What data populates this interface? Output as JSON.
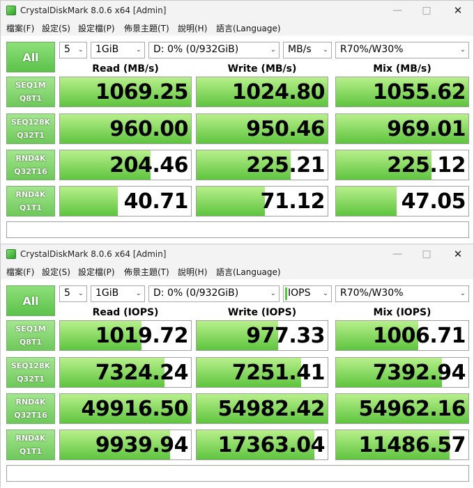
{
  "windows": [
    {
      "title": "CrystalDiskMark 8.0.6 x64 [Admin]",
      "menu": [
        "檔案(F)",
        "設定(S)",
        "設定檔(P)",
        "佈景主題(T)",
        "說明(H)",
        "語言(Language)"
      ],
      "all_label": "All",
      "count": "5",
      "size": "1GiB",
      "drive": "D: 0% (0/932GiB)",
      "unit": "MB/s",
      "mix": "R70%/W30%",
      "headers": [
        "Read (MB/s)",
        "Write (MB/s)",
        "Mix (MB/s)"
      ],
      "rows": [
        {
          "line1": "SEQ1M",
          "line2": "Q8T1",
          "values": [
            "1069.25",
            "1024.80",
            "1055.62"
          ],
          "fill": [
            1.0,
            1.0,
            1.0
          ]
        },
        {
          "line1": "SEQ128K",
          "line2": "Q32T1",
          "values": [
            "960.00",
            "950.46",
            "969.01"
          ],
          "fill": [
            1.0,
            1.0,
            1.0
          ]
        },
        {
          "line1": "RND4K",
          "line2": "Q32T16",
          "values": [
            "204.46",
            "225.21",
            "225.12"
          ],
          "fill": [
            0.69,
            0.72,
            0.72
          ]
        },
        {
          "line1": "RND4K",
          "line2": "Q1T1",
          "values": [
            "40.71",
            "71.12",
            "47.05"
          ],
          "fill": [
            0.44,
            0.52,
            0.46
          ]
        }
      ],
      "status": ""
    },
    {
      "title": "CrystalDiskMark 8.0.6 x64 [Admin]",
      "menu": [
        "檔案(F)",
        "設定(S)",
        "設定檔(P)",
        "佈景主題(T)",
        "說明(H)",
        "語言(Language)"
      ],
      "all_label": "All",
      "count": "5",
      "size": "1GiB",
      "drive": "D: 0% (0/932GiB)",
      "unit": "IOPS",
      "mix": "R70%/W30%",
      "headers": [
        "Read (IOPS)",
        "Write (IOPS)",
        "Mix (IOPS)"
      ],
      "rows": [
        {
          "line1": "SEQ1M",
          "line2": "Q8T1",
          "values": [
            "1019.72",
            "977.33",
            "1006.71"
          ],
          "fill": [
            0.62,
            0.62,
            0.62
          ]
        },
        {
          "line1": "SEQ128K",
          "line2": "Q32T1",
          "values": [
            "7324.24",
            "7251.41",
            "7392.94"
          ],
          "fill": [
            0.8,
            0.8,
            0.8
          ]
        },
        {
          "line1": "RND4K",
          "line2": "Q32T16",
          "values": [
            "49916.50",
            "54982.42",
            "54962.16"
          ],
          "fill": [
            1.0,
            1.0,
            1.0
          ]
        },
        {
          "line1": "RND4K",
          "line2": "Q1T1",
          "values": [
            "9939.94",
            "17363.04",
            "11486.57"
          ],
          "fill": [
            0.84,
            0.9,
            0.86
          ]
        }
      ],
      "status": ""
    }
  ],
  "colors": {
    "accent_green": "#5ec43e",
    "label_green": "#6ec85a"
  }
}
